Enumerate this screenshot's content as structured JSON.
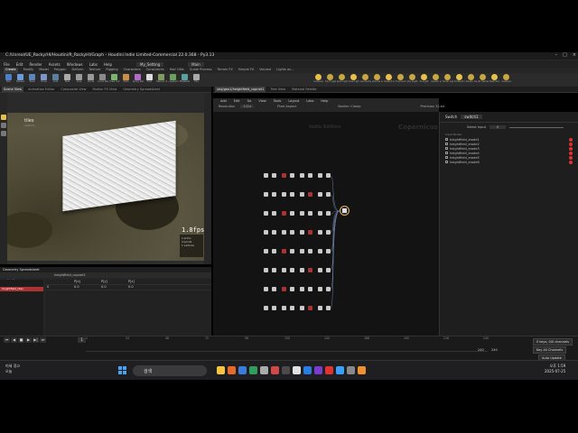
{
  "window": {
    "title": "C:/Unreal/UE_Rocky/HI/Houdini/R_RockyHI/Graph - Houdini Indie Limited-Commercial 22.0.368 - Py3.13"
  },
  "menu": [
    "File",
    "Edit",
    "Render",
    "Assets",
    "Windows",
    "Labs",
    "Help"
  ],
  "menu_extra": [
    "My_Setting",
    "Main"
  ],
  "shelf_tabs": [
    "Create",
    "Modify",
    "Model",
    "Polygon",
    "Deform",
    "Texture",
    "Rigging",
    "Characters",
    "Constraints",
    "Hair Utils",
    "Guide Process",
    "Terrain FX",
    "Simple FX",
    "Volume",
    "Lights an..."
  ],
  "shelf_tools": [
    "Box",
    "Sphere",
    "Tube",
    "Torus",
    "Grid",
    "Null",
    "Line",
    "Circle",
    "Curve Bezier",
    "Draw Curve",
    "Path",
    "Spray Paint",
    "Font",
    "Platonic Solids",
    "L-System",
    "Metaball",
    "File"
  ],
  "light_tools": [
    "Camera",
    "Point Light",
    "Spot Light",
    "Area Light",
    "Geometry Light",
    "Volume Light",
    "Distant Light",
    "Environment Light",
    "Sky Light",
    "GI Light",
    "Caustic Light",
    "Portal Light",
    "Ambient Light",
    "Stereo Camera",
    "VR Camera",
    "Switcher",
    "Camera"
  ],
  "pane_tabs_left": [
    "Scene View",
    "Animation Editor",
    "Composite View",
    "Motion FX View",
    "Geometry Spreadsheet"
  ],
  "pane_tabs_right": [
    "/obj/geo1/heightfield_copnet1",
    "Tree View",
    "Material Palette"
  ],
  "viewport": {
    "node_name": "tiles",
    "node_sub": "switch1",
    "fps": "1.8fps",
    "stats": [
      "1  prims",
      "4  points",
      "1  vertices"
    ]
  },
  "geo_spreadsheet": {
    "title": "Geometry Spreadsheet",
    "path": "heightfield_copnet1",
    "node": "switch1",
    "cols": [
      "",
      "P[x]",
      "P[y]",
      "P[z]"
    ],
    "row": [
      "0",
      "0.0",
      "0.0",
      "0.0"
    ],
    "item": "heightfield_tiles"
  },
  "network": {
    "menus": [
      "Add",
      "Edit",
      "Go",
      "View",
      "Tools",
      "Layout",
      "Labs",
      "Help"
    ],
    "resolution_label": "Resolution",
    "resolution_value": "1024",
    "pixel_label": "Pixel Aspect",
    "border": "Border: Clamp",
    "precision": "Precision 32-bit",
    "edition": "Indie Edition",
    "context": "Copernicus"
  },
  "params": {
    "node_type": "Switch",
    "node_name": "switch1",
    "select_input_label": "Select Input",
    "select_input_value": "0",
    "inputs_label": "Input Nodes",
    "inputs": [
      "heightfield_erode1",
      "heightfield_erode2",
      "heightfield_erode3",
      "heightfield_erode4",
      "heightfield_erode5",
      "heightfield_erode6"
    ]
  },
  "timeline": {
    "frame": "1",
    "ticks": [
      "1",
      "24",
      "48",
      "72",
      "96",
      "120",
      "144",
      "168",
      "192",
      "216",
      "240"
    ],
    "end_a": "240",
    "end_b": "240"
  },
  "keys": {
    "channels": "0 keys, 0/0 channels",
    "all_channels": "Key All Channels",
    "auto_update": "Auto Update"
  },
  "taskbar": {
    "weather_title": "미세 경고",
    "weather_sub": "오늘",
    "search": "검색",
    "time": "오후 1:59",
    "date": "2025-07-25"
  },
  "colors": {
    "accent": "#d93333",
    "node_red": "#a33333",
    "selected_node": "#f0c040"
  }
}
